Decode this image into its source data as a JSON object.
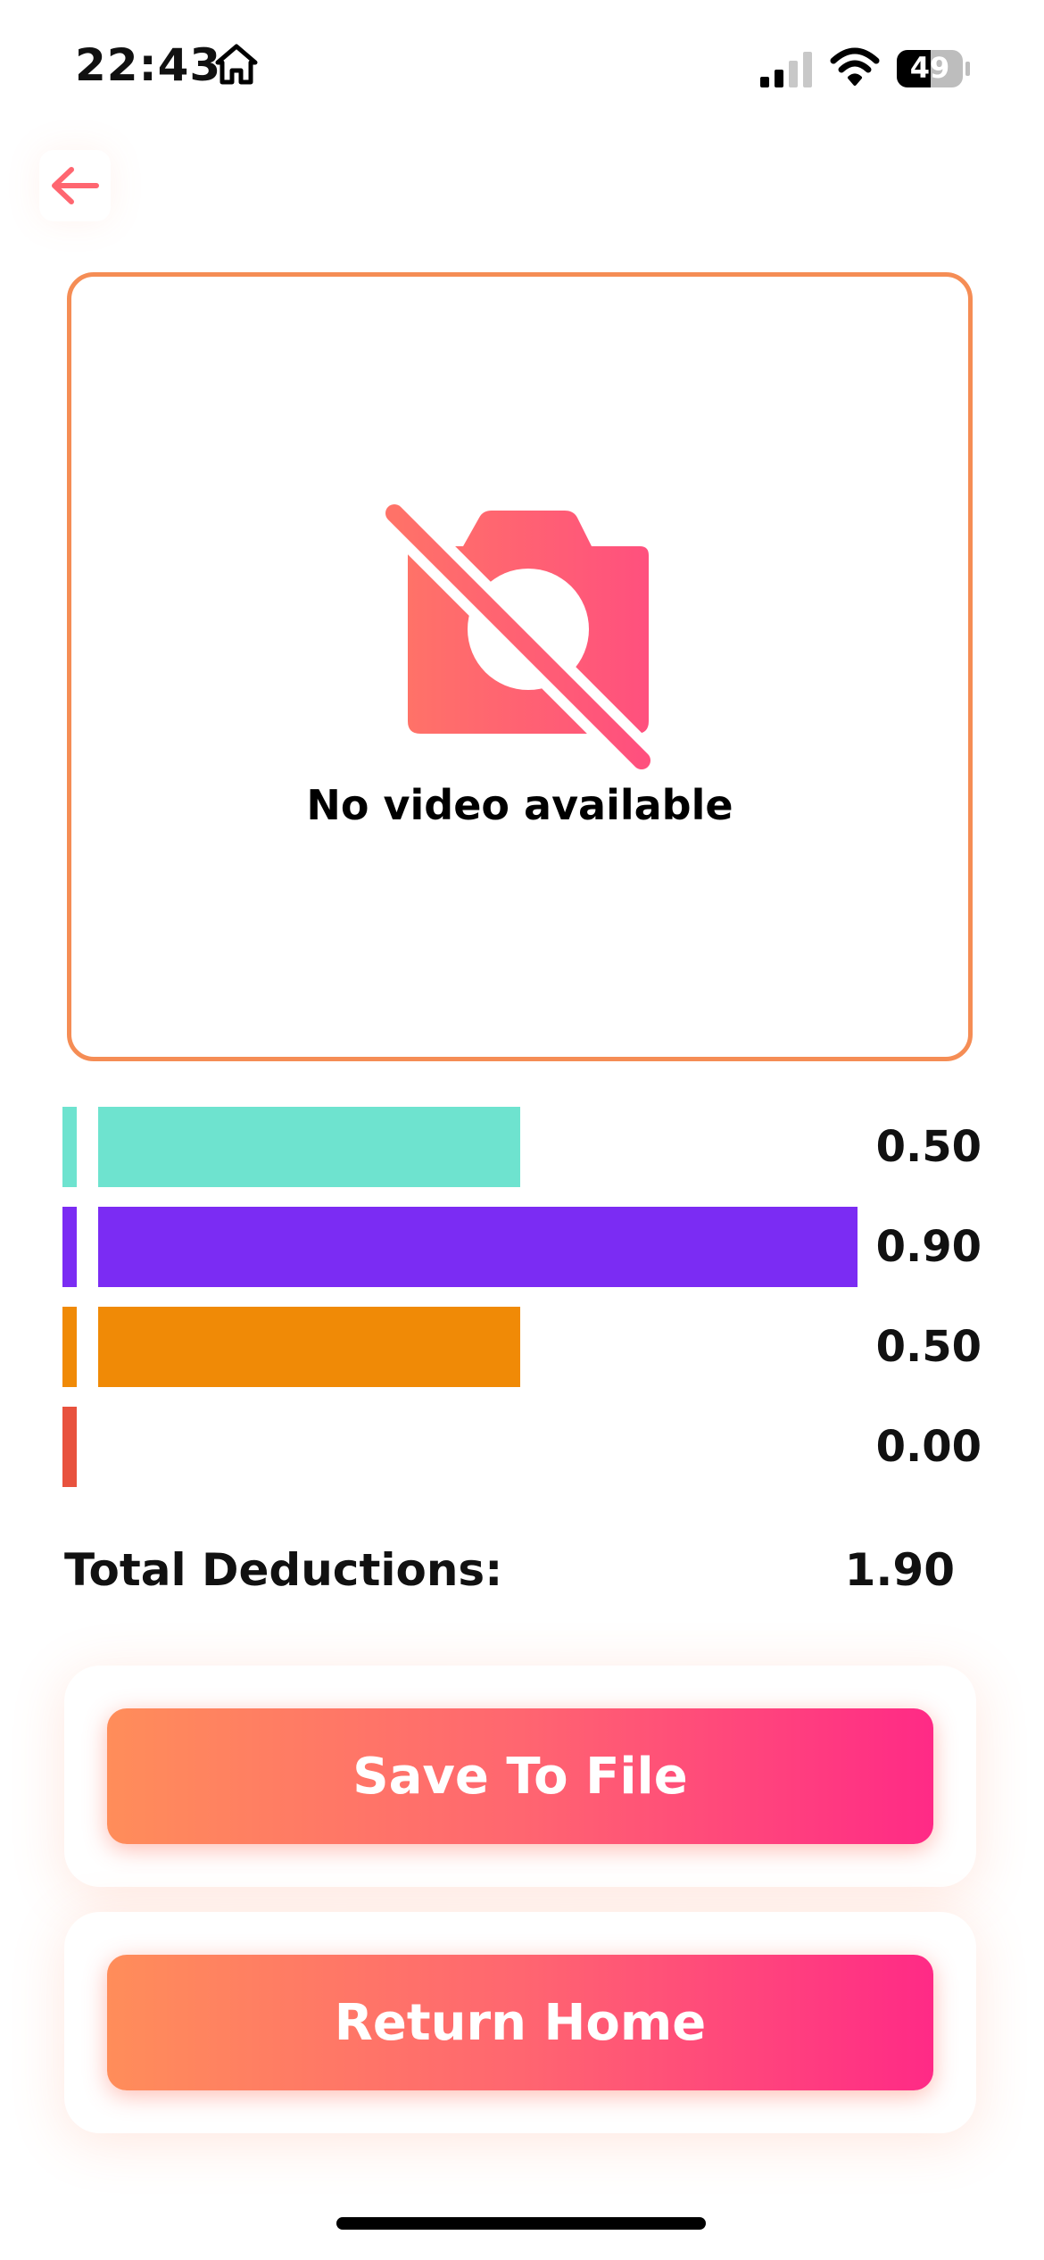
{
  "status_bar": {
    "time": "22:43",
    "battery": "49"
  },
  "video": {
    "message": "No video available",
    "border_color": "#f58d55"
  },
  "deductions": [
    {
      "value_label": "0.50",
      "fraction": 0.5,
      "color": "#6ee3cf"
    },
    {
      "value_label": "0.90",
      "fraction": 0.9,
      "color": "#7b2cf3"
    },
    {
      "value_label": "0.50",
      "fraction": 0.5,
      "color": "#f08a06"
    },
    {
      "value_label": "0.00",
      "fraction": 0.0,
      "color": "#e8523e"
    }
  ],
  "total": {
    "label": "Total Deductions:",
    "value": "1.90"
  },
  "buttons": {
    "save": "Save To File",
    "home": "Return Home"
  },
  "colors": {
    "accent_start": "#ff8d5a",
    "accent_end": "#ff2a86"
  },
  "icons": {
    "back": "arrow-left-icon",
    "no_video": "camera-off-icon",
    "status_home": "home-icon",
    "signal": "signal-icon",
    "wifi": "wifi-icon",
    "battery": "battery-icon"
  }
}
